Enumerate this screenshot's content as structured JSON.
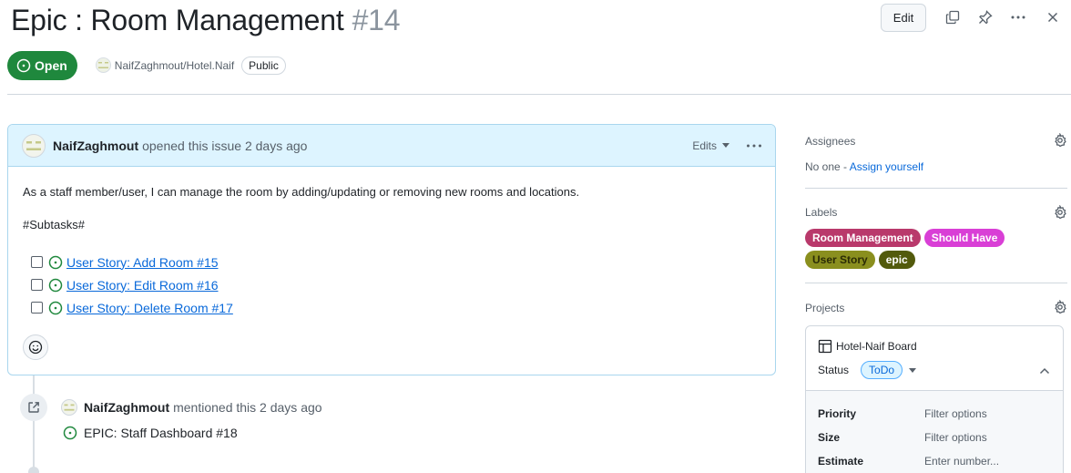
{
  "issue": {
    "title": "Epic : Room Management",
    "number": "#14",
    "state": "Open",
    "repo": "NaifZaghmout/Hotel.Naif",
    "visibility": "Public"
  },
  "toolbar": {
    "edit_label": "Edit"
  },
  "comment": {
    "author": "NaifZaghmout",
    "opened_text": "opened this issue 2 days ago",
    "edits_label": "Edits",
    "body": "As a staff member/user, I can manage the room by adding/updating or removing new rooms and locations.",
    "subtasks_heading": "#Subtasks#",
    "tasks": [
      {
        "label": "User Story: Add Room #15",
        "checked": false
      },
      {
        "label": "User Story: Edit Room #16",
        "checked": false
      },
      {
        "label": "User Story: Delete Room #17",
        "checked": false
      }
    ]
  },
  "timeline": {
    "author": "NaifZaghmout",
    "action": "mentioned this 2 days ago",
    "reference": "EPIC: Staff Dashboard #18"
  },
  "sidebar": {
    "assignees": {
      "title": "Assignees",
      "none_text": "No one -",
      "assign_link": "Assign yourself"
    },
    "labels": {
      "title": "Labels",
      "items": [
        {
          "name": "Room Management",
          "bg": "#b60205",
          "fg": "#ffffff",
          "tint": "#b9396b"
        },
        {
          "name": "Should Have",
          "bg": "#d93fd6",
          "fg": "#ffffff"
        },
        {
          "name": "User Story",
          "bg": "#8a8f1e",
          "fg": "#2b2b05"
        },
        {
          "name": "epic",
          "bg": "#525a0c",
          "fg": "#ffffff"
        }
      ]
    },
    "projects": {
      "title": "Projects",
      "board_name": "Hotel-Naif Board",
      "status_label": "Status",
      "status_value": "ToDo",
      "fields": [
        {
          "name": "Priority",
          "value": "Filter options"
        },
        {
          "name": "Size",
          "value": "Filter options"
        },
        {
          "name": "Estimate",
          "value": "Enter number..."
        }
      ]
    }
  },
  "colors": {
    "open_green": "#1f883d",
    "link_blue": "#0969da",
    "comment_header_bg": "#ddf4ff"
  }
}
